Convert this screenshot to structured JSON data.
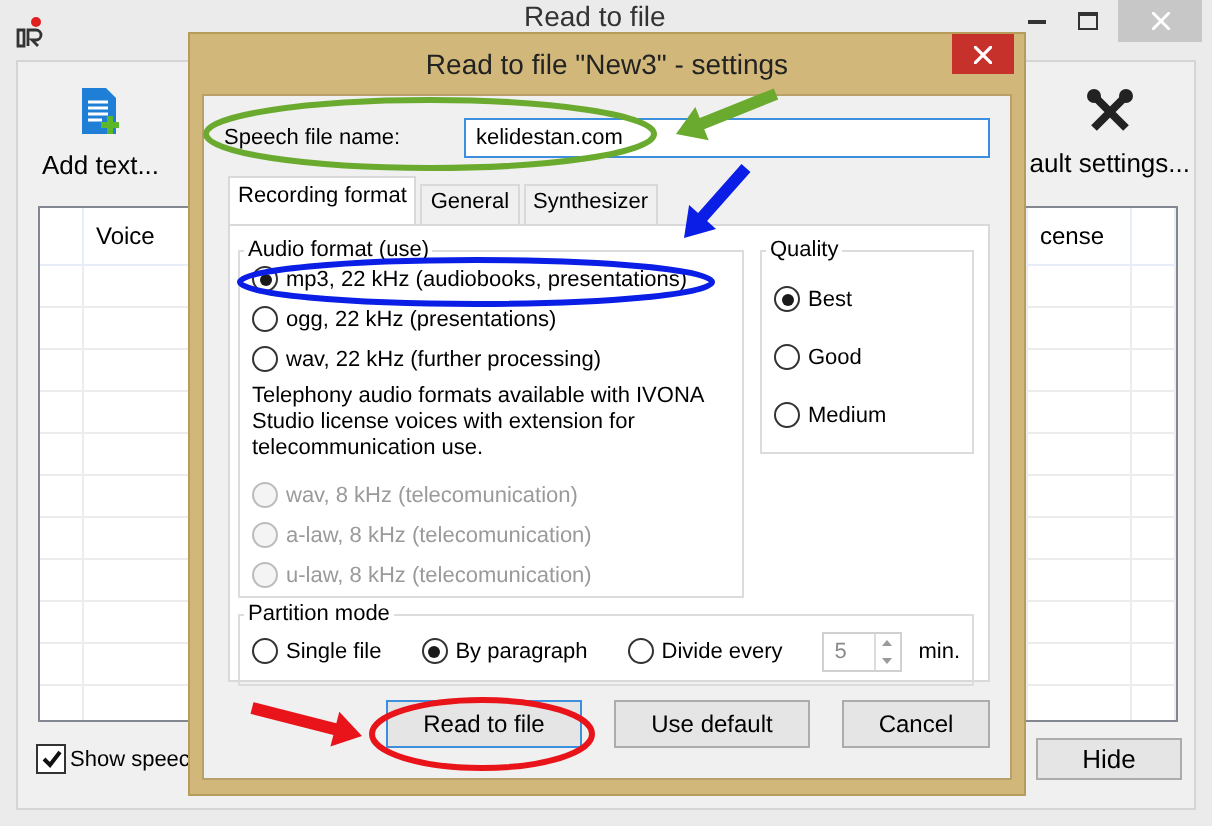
{
  "main_window": {
    "title": "Read to file",
    "toolbar": [
      {
        "kind": "add",
        "label": "Add text..."
      },
      {
        "kind": "settings",
        "label": "ault settings..."
      }
    ],
    "table": {
      "columns": [
        "Voice",
        "cense"
      ]
    },
    "show_checkbox": {
      "label": "Show speec",
      "checked": true
    },
    "hide_button": "Hide"
  },
  "dialog": {
    "title": "Read to file \"New3\" - settings",
    "file_name": {
      "label": "Speech file name:",
      "value": "kelidestan.com"
    },
    "tabs": [
      {
        "label": "Recording format",
        "selected": true
      },
      {
        "label": "General",
        "selected": false
      },
      {
        "label": "Synthesizer",
        "selected": false
      }
    ],
    "audio_format": {
      "title": "Audio format (use)",
      "options": [
        {
          "label": "mp3, 22 kHz (audiobooks, presentations)",
          "selected": true,
          "disabled": false
        },
        {
          "label": "ogg, 22 kHz (presentations)",
          "selected": false,
          "disabled": false
        },
        {
          "label": "wav, 22 kHz (further processing)",
          "selected": false,
          "disabled": false
        }
      ],
      "note": "Telephony audio formats available with IVONA Studio license voices with extension for telecommunication use.",
      "telephony_options": [
        {
          "label": "wav, 8 kHz (telecomunication)",
          "selected": false,
          "disabled": true
        },
        {
          "label": "a-law, 8 kHz (telecomunication)",
          "selected": false,
          "disabled": true
        },
        {
          "label": "u-law, 8 kHz (telecomunication)",
          "selected": false,
          "disabled": true
        }
      ]
    },
    "quality": {
      "title": "Quality",
      "options": [
        {
          "label": "Best",
          "selected": true
        },
        {
          "label": "Good",
          "selected": false
        },
        {
          "label": "Medium",
          "selected": false
        }
      ]
    },
    "partition": {
      "title": "Partition mode",
      "options": [
        {
          "label": "Single file",
          "selected": false
        },
        {
          "label": "By paragraph",
          "selected": true
        },
        {
          "label": "Divide every",
          "selected": false
        }
      ],
      "minutes": {
        "value": "5",
        "disabled": true
      },
      "unit": "min."
    },
    "buttons": [
      "Read to file",
      "Use default",
      "Cancel"
    ]
  },
  "annotations": [
    {
      "color": "#6aab2f"
    },
    {
      "color": "#0a1ee6"
    },
    {
      "color": "#e8141a"
    }
  ]
}
